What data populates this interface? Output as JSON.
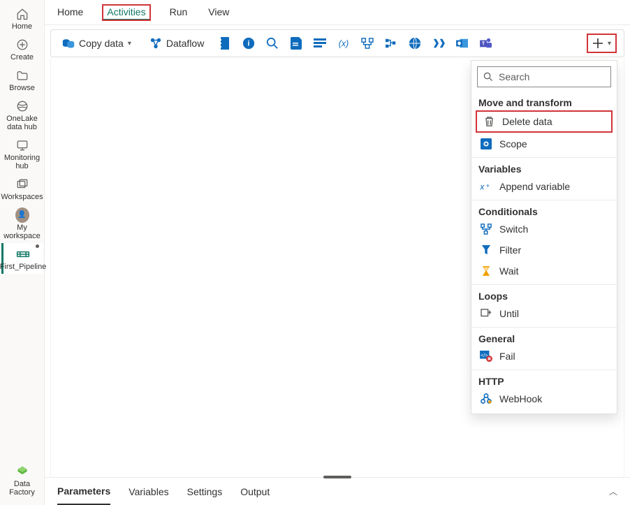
{
  "rail": [
    {
      "key": "home",
      "label": "Home"
    },
    {
      "key": "create",
      "label": "Create"
    },
    {
      "key": "browse",
      "label": "Browse"
    },
    {
      "key": "onelake",
      "label": "OneLake data hub"
    },
    {
      "key": "monitoring",
      "label": "Monitoring hub"
    },
    {
      "key": "workspaces",
      "label": "Workspaces"
    },
    {
      "key": "myws",
      "label": "My workspace"
    },
    {
      "key": "pipeline",
      "label": "First_Pipeline"
    }
  ],
  "rail_footer": {
    "label": "Data Factory"
  },
  "tabs": [
    {
      "label": "Home"
    },
    {
      "label": "Activities",
      "active": true,
      "highlight": true
    },
    {
      "label": "Run"
    },
    {
      "label": "View"
    }
  ],
  "toolbar": {
    "copy_data": "Copy data",
    "dataflow": "Dataflow"
  },
  "panel": {
    "search_placeholder": "Search",
    "groups": [
      {
        "title": "Move and transform",
        "items": [
          {
            "key": "delete",
            "label": "Delete data",
            "highlight": true
          },
          {
            "key": "scope",
            "label": "Scope"
          }
        ]
      },
      {
        "title": "Variables",
        "items": [
          {
            "key": "append",
            "label": "Append variable"
          }
        ]
      },
      {
        "title": "Conditionals",
        "items": [
          {
            "key": "switch",
            "label": "Switch"
          },
          {
            "key": "filter",
            "label": "Filter"
          },
          {
            "key": "wait",
            "label": "Wait"
          }
        ]
      },
      {
        "title": "Loops",
        "items": [
          {
            "key": "until",
            "label": "Until"
          }
        ]
      },
      {
        "title": "General",
        "items": [
          {
            "key": "fail",
            "label": "Fail"
          }
        ]
      },
      {
        "title": "HTTP",
        "items": [
          {
            "key": "webhook",
            "label": "WebHook"
          }
        ]
      }
    ]
  },
  "bottom_tabs": [
    {
      "label": "Parameters",
      "active": true
    },
    {
      "label": "Variables"
    },
    {
      "label": "Settings"
    },
    {
      "label": "Output"
    }
  ]
}
